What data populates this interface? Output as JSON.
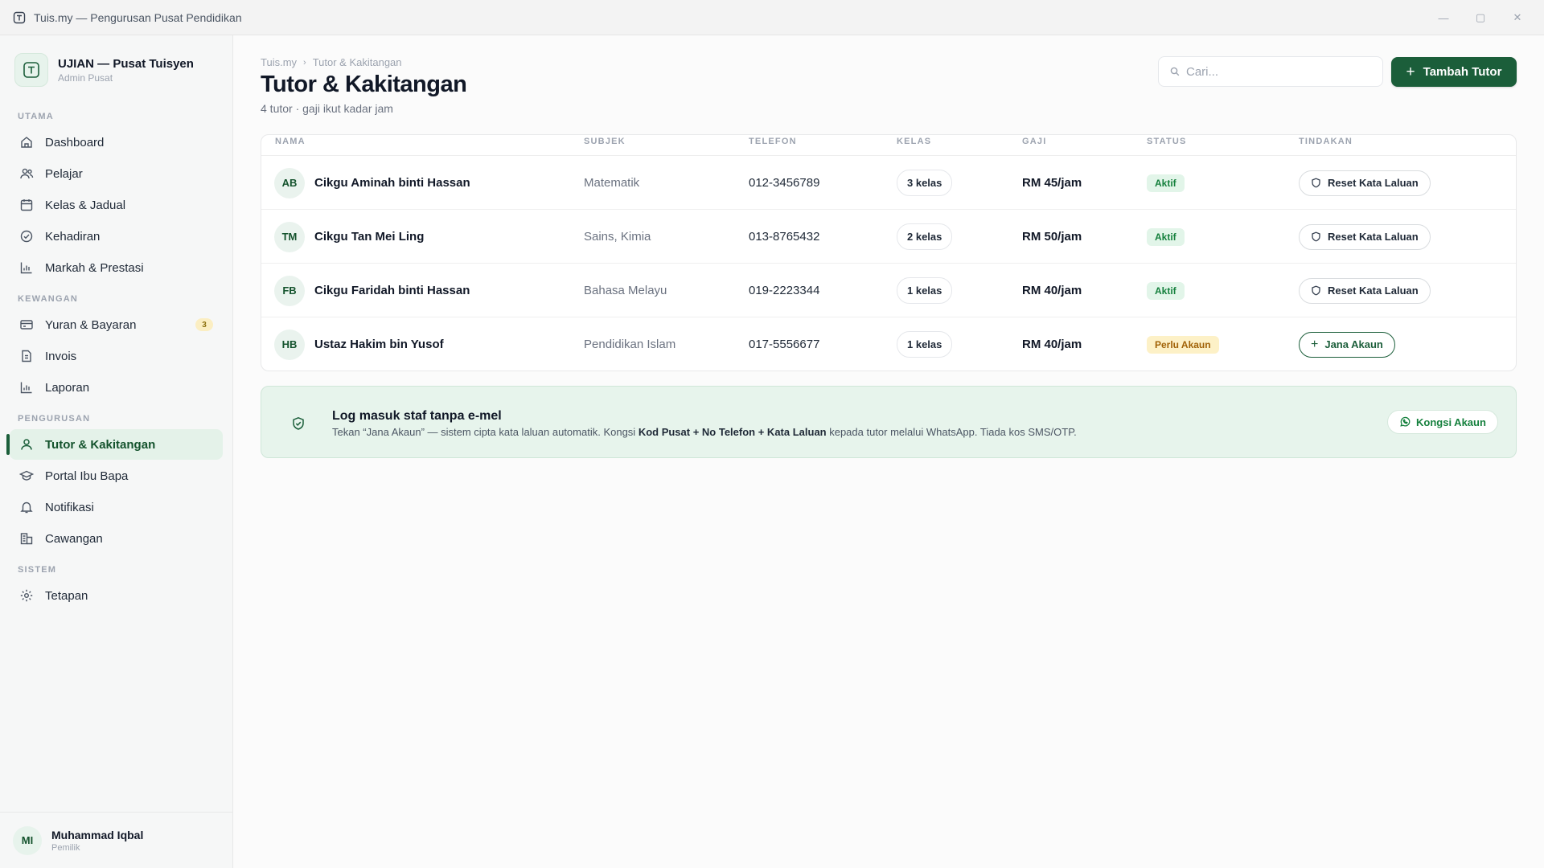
{
  "window": {
    "title": "Tuis.my — Pengurusan Pusat Pendidikan",
    "controls": {
      "minimize": "—",
      "maximize": "▢",
      "close": "✕"
    }
  },
  "sidebar": {
    "brand": {
      "name": "UJIAN — Pusat Tuisyen",
      "role": "Admin Pusat",
      "logo_letter": "T"
    },
    "sections": {
      "utama": "UTAMA",
      "kewangan": "KEWANGAN",
      "pengurusan": "PENGURUSAN",
      "sistem": "SISTEM"
    },
    "items": [
      {
        "label": "Dashboard",
        "icon": "home-icon"
      },
      {
        "label": "Pelajar",
        "icon": "users-icon"
      },
      {
        "label": "Kelas & Jadual",
        "icon": "calendar-icon"
      },
      {
        "label": "Kehadiran",
        "icon": "check-circle-icon"
      },
      {
        "label": "Markah & Prestasi",
        "icon": "bar-chart-icon"
      },
      {
        "label": "Yuran & Bayaran",
        "icon": "credit-card-icon",
        "badge": "3"
      },
      {
        "label": "Invois",
        "icon": "file-icon"
      },
      {
        "label": "Laporan",
        "icon": "bar-chart-icon"
      },
      {
        "label": "Tutor & Kakitangan",
        "icon": "user-icon",
        "active": true
      },
      {
        "label": "Portal Ibu Bapa",
        "icon": "graduation-cap-icon"
      },
      {
        "label": "Notifikasi",
        "icon": "bell-icon"
      },
      {
        "label": "Cawangan",
        "icon": "building-icon"
      },
      {
        "label": "Tetapan",
        "icon": "gear-icon"
      }
    ],
    "user": {
      "initials": "MI",
      "name": "Muhammad Iqbal",
      "role": "Pemilik"
    }
  },
  "header": {
    "breadcrumb": [
      "Tuis.my",
      "Tutor & Kakitangan"
    ],
    "breadcrumb_sep": "›",
    "title": "Tutor & Kakitangan",
    "subtitle": "4 tutor · gaji ikut kadar jam",
    "search_placeholder": "Cari...",
    "add_button": "Tambah Tutor",
    "add_button_glyph": "+"
  },
  "table": {
    "columns": [
      "NAMA",
      "SUBJEK",
      "TELEFON",
      "KELAS",
      "GAJI",
      "STATUS",
      "TINDAKAN"
    ],
    "rows": [
      {
        "initials": "AB",
        "name": "Cikgu Aminah binti Hassan",
        "subject": "Matematik",
        "phone": "012-3456789",
        "classes": "3 kelas",
        "pay": "RM 45/jam",
        "status": "Aktif",
        "status_kind": "ok",
        "action": "Reset Kata Laluan"
      },
      {
        "initials": "TM",
        "name": "Cikgu Tan Mei Ling",
        "subject": "Sains, Kimia",
        "phone": "013-8765432",
        "classes": "2 kelas",
        "pay": "RM 50/jam",
        "status": "Aktif",
        "status_kind": "ok",
        "action": "Reset Kata Laluan"
      },
      {
        "initials": "FB",
        "name": "Cikgu Faridah binti Hassan",
        "subject": "Bahasa Melayu",
        "phone": "019-2223344",
        "classes": "1 kelas",
        "pay": "RM 40/jam",
        "status": "Aktif",
        "status_kind": "ok",
        "action": "Reset Kata Laluan"
      },
      {
        "initials": "HB",
        "name": "Ustaz Hakim bin Yusof",
        "subject": "Pendidikan Islam",
        "phone": "017-5556677",
        "classes": "1 kelas",
        "pay": "RM 40/jam",
        "status": "Perlu Akaun",
        "status_kind": "warn",
        "action": "Jana Akaun"
      }
    ]
  },
  "banner": {
    "title": "Log masuk staf tanpa e-mel",
    "text_1": "Tekan “Jana Akaun” — sistem cipta kata laluan automatik. Kongsi ",
    "text_bold": "Kod Pusat + No Telefon + Kata Laluan",
    "text_2": " kepada tutor melalui WhatsApp. Tiada kos SMS/OTP.",
    "button": "Kongsi Akaun"
  },
  "colors": {
    "accent": "#1b5e3a",
    "active_bg": "#e4f2e9",
    "status_ok": "#15803d",
    "status_warn": "#a16207",
    "banner_bg": "#e7f4ec"
  }
}
